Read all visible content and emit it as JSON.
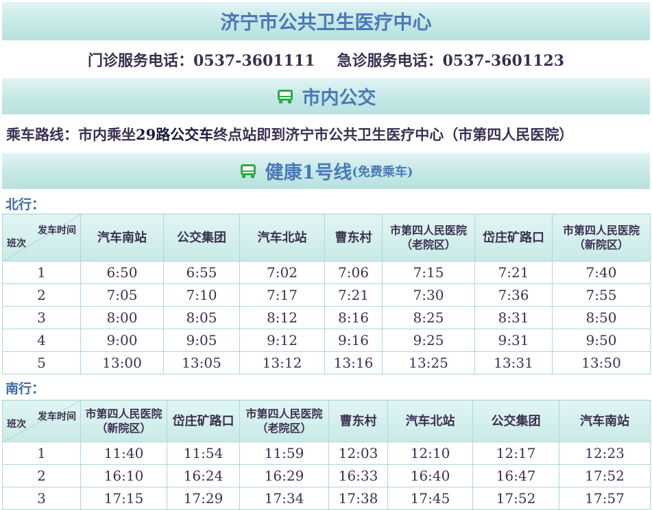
{
  "header": {
    "title": "济宁市公共卫生医疗中心",
    "outpatient_phone": "门诊服务电话：0537-3601111",
    "emergency_phone": "急诊服务电话：0537-3601123"
  },
  "city_bus": {
    "title": "市内公交",
    "icon": "bus-icon",
    "route_prefix": "乘车路线：市内乘坐",
    "route_strong": "29路公交车",
    "route_suffix": "终点站即到济宁市公共卫生医疗中心（市第四人民医院）"
  },
  "health_line": {
    "title": "健康1号线",
    "note": "(免费乘车)",
    "icon": "bus-icon"
  },
  "colors": {
    "band_top": "#e2f5f4",
    "band_bottom": "#b8e2df",
    "title_text": "#4a78b8",
    "bus_icon": "#2eaa4a",
    "border": "#a8d8d6"
  },
  "north": {
    "label": "北行：",
    "corner_top": "发车时间",
    "corner_bottom": "班次",
    "stops": [
      {
        "l1": "汽车南站",
        "l2": ""
      },
      {
        "l1": "公交集团",
        "l2": ""
      },
      {
        "l1": "汽车北站",
        "l2": ""
      },
      {
        "l1": "曹东村",
        "l2": ""
      },
      {
        "l1": "市第四人民医院",
        "l2": "（老院区）"
      },
      {
        "l1": "岱庄矿路口",
        "l2": ""
      },
      {
        "l1": "市第四人民医院",
        "l2": "（新院区）"
      }
    ],
    "rows": [
      [
        "1",
        "6:50",
        "6:55",
        "7:02",
        "7:06",
        "7:15",
        "7:21",
        "7:40"
      ],
      [
        "2",
        "7:05",
        "7:10",
        "7:17",
        "7:21",
        "7:30",
        "7:36",
        "7:55"
      ],
      [
        "3",
        "8:00",
        "8:05",
        "8:12",
        "8:16",
        "8:25",
        "8:31",
        "8:50"
      ],
      [
        "4",
        "9:00",
        "9:05",
        "9:12",
        "9:16",
        "9:25",
        "9:31",
        "9:50"
      ],
      [
        "5",
        "13:00",
        "13:05",
        "13:12",
        "13:16",
        "13:25",
        "13:31",
        "13:50"
      ]
    ]
  },
  "south": {
    "label": "南行：",
    "corner_top": "发车时间",
    "corner_bottom": "班次",
    "stops": [
      {
        "l1": "市第四人民医院",
        "l2": "（新院区）"
      },
      {
        "l1": "岱庄矿路口",
        "l2": ""
      },
      {
        "l1": "市第四人民医院",
        "l2": "（老院区）"
      },
      {
        "l1": "曹东村",
        "l2": ""
      },
      {
        "l1": "汽车北站",
        "l2": ""
      },
      {
        "l1": "公交集团",
        "l2": ""
      },
      {
        "l1": "汽车南站",
        "l2": ""
      }
    ],
    "rows": [
      [
        "1",
        "11:40",
        "11:54",
        "11:59",
        "12:03",
        "12:10",
        "12:17",
        "12:23"
      ],
      [
        "2",
        "16:10",
        "16:24",
        "16:29",
        "16:33",
        "16:40",
        "16:47",
        "17:52"
      ],
      [
        "3",
        "17:15",
        "17:29",
        "17:34",
        "17:38",
        "17:45",
        "17:52",
        "17:57"
      ]
    ]
  }
}
